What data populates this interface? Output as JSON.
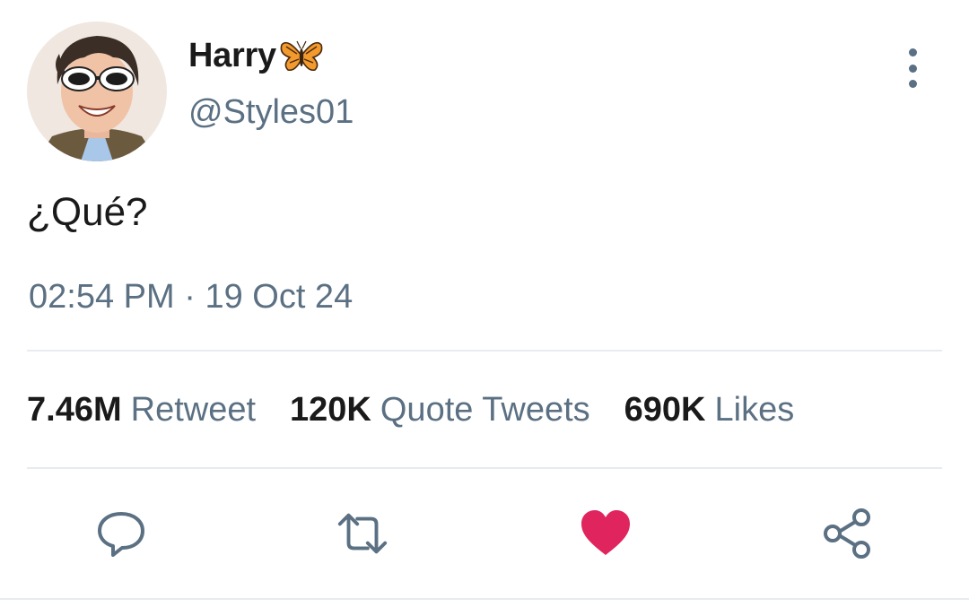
{
  "user": {
    "display_name": "Harry",
    "handle": "@Styles01",
    "avatar_icon": "profile-photo",
    "badge_icon": "butterfly-emoji"
  },
  "tweet": {
    "text": "¿Qué?",
    "time": "02:54 PM",
    "separator": "·",
    "date": "19 Oct 24"
  },
  "stats": [
    {
      "count": "7.46M",
      "label": "Retweet"
    },
    {
      "count": "120K",
      "label": "Quote Tweets"
    },
    {
      "count": "690K",
      "label": "Likes"
    }
  ],
  "actions": {
    "reply_icon": "reply-icon",
    "retweet_icon": "retweet-icon",
    "like_icon": "heart-icon",
    "share_icon": "share-icon",
    "liked": true
  },
  "colors": {
    "text_primary": "#1a1a1a",
    "text_secondary": "#5b7083",
    "divider": "#e6ecf0",
    "like_active": "#e0245e"
  }
}
